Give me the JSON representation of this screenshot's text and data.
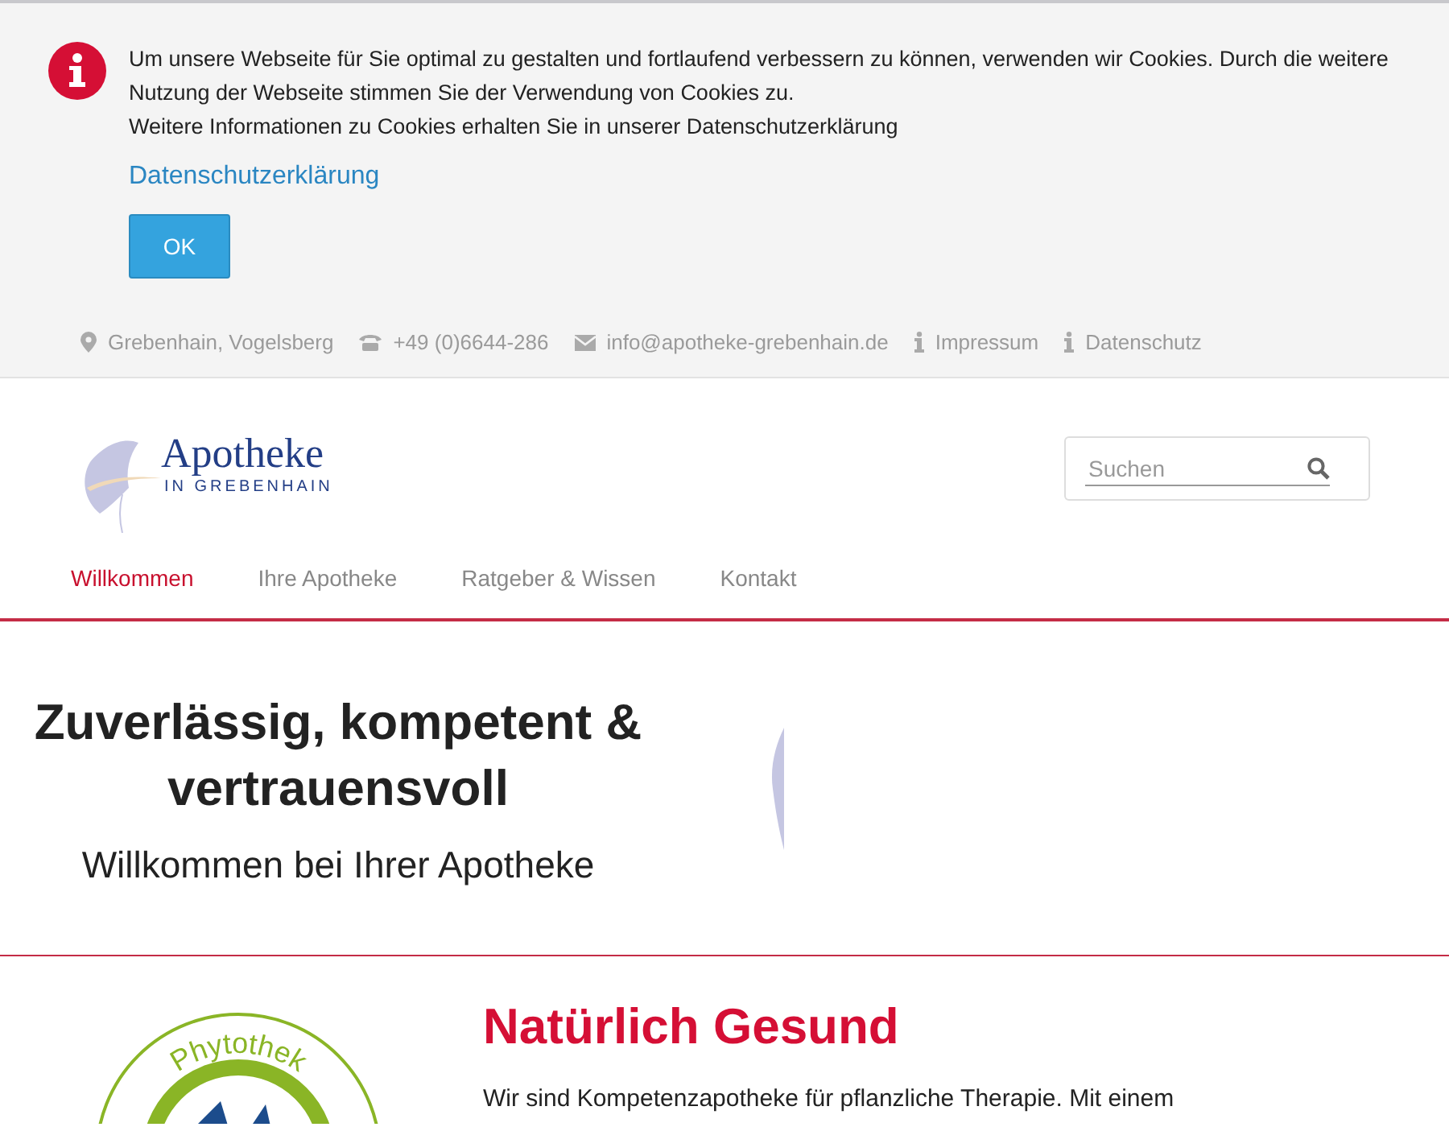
{
  "cookie_notice": {
    "text": "Um unsere Webseite für Sie optimal zu gestalten und fortlaufend verbessern zu können, verwenden wir Cookies. Durch die weitere Nutzung der Webseite stimmen Sie der Verwendung von Cookies zu.",
    "text_2": "Weitere Informationen zu Cookies erhalten Sie in unserer Datenschutzerklärung",
    "link": "Datenschutzerklärung",
    "button": "OK"
  },
  "contact_bar": [
    {
      "kind": "location",
      "label": "Grebenhain, Vogelsberg"
    },
    {
      "kind": "phone",
      "label": "+49 (0)6644-286"
    },
    {
      "kind": "mail",
      "label": "info@apotheke-grebenhain.de"
    },
    {
      "kind": "info",
      "label": "Impressum"
    },
    {
      "kind": "info",
      "label": "Datenschutz"
    }
  ],
  "logo": {
    "title": "Apotheke",
    "subtitle": "IN GREBENHAIN"
  },
  "search": {
    "placeholder": "Suchen"
  },
  "nav": [
    {
      "label": "Willkommen",
      "selected": true
    },
    {
      "label": "Ihre Apotheke",
      "selected": false
    },
    {
      "label": "Ratgeber & Wissen",
      "selected": false
    },
    {
      "label": "Kontakt",
      "selected": false
    }
  ],
  "hero": {
    "title": "Zuverlässig, kompetent & vertrauensvoll",
    "subtitle": "Willkommen bei Ihrer Apotheke"
  },
  "section": {
    "badge_text": "Phytothek",
    "title": "Natürlich Gesund",
    "text": "Wir sind Kompetenzapotheke für pflanzliche Therapie. Mit einem"
  }
}
